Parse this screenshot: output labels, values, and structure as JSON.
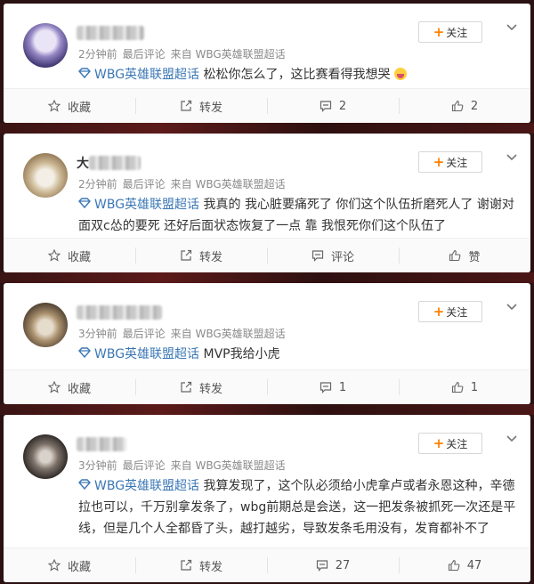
{
  "comments": [
    {
      "name": "",
      "meta": {
        "time": "2分钟前",
        "type": "最后评论",
        "source": "来自 WBG英雄联盟超话"
      },
      "topic": "WBG英雄联盟超话",
      "text": "松松你怎么了，这比赛看得我想哭",
      "follow": "关注",
      "actions": {
        "favorite": "收藏",
        "repost": "转发",
        "comment": "2",
        "like": "2"
      }
    },
    {
      "name": "大",
      "meta": {
        "time": "2分钟前",
        "type": "最后评论",
        "source": "来自 WBG英雄联盟超话"
      },
      "topic": "WBG英雄联盟超话",
      "text": "我真的 我心脏要痛死了 你们这个队伍折磨死人了 谢谢对面双c怂的要死 还好后面状态恢复了一点 靠 我恨死你们这个队伍了",
      "follow": "关注",
      "actions": {
        "favorite": "收藏",
        "repost": "转发",
        "comment": "评论",
        "like": "赞"
      }
    },
    {
      "name": "",
      "meta": {
        "time": "3分钟前",
        "type": "最后评论",
        "source": "来自 WBG英雄联盟超话"
      },
      "topic": "WBG英雄联盟超话",
      "text": "MVP我给小虎",
      "follow": "关注",
      "actions": {
        "favorite": "收藏",
        "repost": "转发",
        "comment": "1",
        "like": "1"
      }
    },
    {
      "name": "",
      "meta": {
        "time": "3分钟前",
        "type": "最后评论",
        "source": "来自 WBG英雄联盟超话"
      },
      "topic": "WBG英雄联盟超话",
      "text": "我算发现了，这个队必须给小虎拿卢或者永恩这种，辛德拉也可以，千万别拿发条了，wbg前期总是会送，这一把发条被抓死一次还是平线，但是几个人全都昏了头，越打越劣，导致发条毛用没有，发育都补不了",
      "follow": "关注",
      "actions": {
        "favorite": "收藏",
        "repost": "转发",
        "comment": "27",
        "like": "47"
      }
    }
  ],
  "colors": {
    "topic": "#3b77b6",
    "plus": "#ff8200",
    "background": "#2a1212"
  }
}
